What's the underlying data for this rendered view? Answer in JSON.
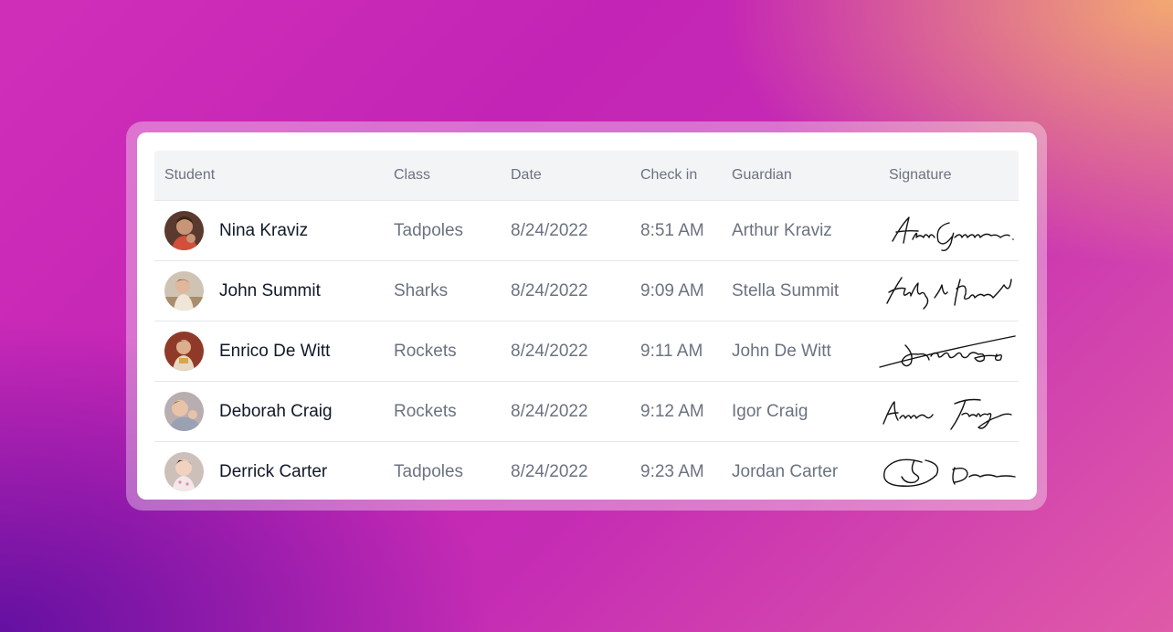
{
  "columns": {
    "student": "Student",
    "class": "Class",
    "date": "Date",
    "checkin": "Check in",
    "guardian": "Guardian",
    "signature": "Signature"
  },
  "rows": [
    {
      "student": "Nina Kraviz",
      "class": "Tadpoles",
      "date": "8/24/2022",
      "checkin": "8:51 AM",
      "guardian": "Arthur Kraviz",
      "signature": "Alan Garner",
      "avatar_color": "#6b4a3a"
    },
    {
      "student": "John Summit",
      "class": "Sharks",
      "date": "8/24/2022",
      "checkin": "9:09 AM",
      "guardian": "Stella Summit",
      "signature": "Stella Summit",
      "avatar_color": "#b9a58f"
    },
    {
      "student": "Enrico De Witt",
      "class": "Rockets",
      "date": "8/24/2022",
      "checkin": "9:11 AM",
      "guardian": "John De Witt",
      "signature": "John De Witt",
      "avatar_color": "#8f3a28"
    },
    {
      "student": "Deborah Craig",
      "class": "Rockets",
      "date": "8/24/2022",
      "checkin": "9:12 AM",
      "guardian": "Igor Craig",
      "signature": "Igor Craig",
      "avatar_color": "#a89a98"
    },
    {
      "student": "Derrick Carter",
      "class": "Tadpoles",
      "date": "8/24/2022",
      "checkin": "9:23 AM",
      "guardian": "Jordan Carter",
      "signature": "Jordan Carter",
      "avatar_color": "#c7b9b3"
    }
  ],
  "colors": {
    "header_bg": "#f3f4f6",
    "muted_text": "#6b7280",
    "primary_text": "#111827"
  }
}
